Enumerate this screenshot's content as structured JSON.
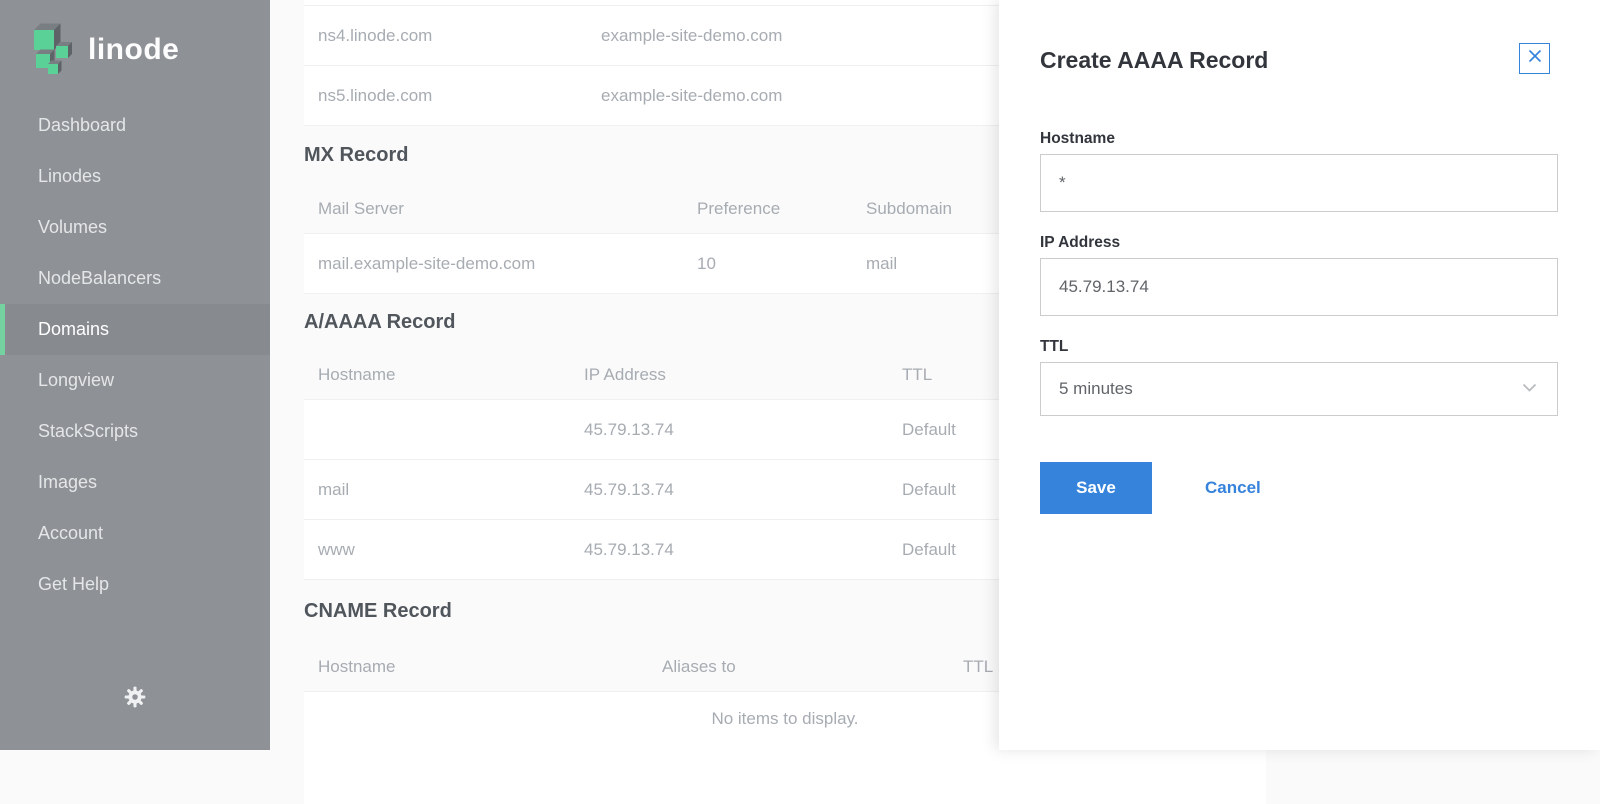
{
  "app": {
    "brand": "linode"
  },
  "sidebar": {
    "items": [
      {
        "label": "Dashboard"
      },
      {
        "label": "Linodes"
      },
      {
        "label": "Volumes"
      },
      {
        "label": "NodeBalancers"
      },
      {
        "label": "Domains"
      },
      {
        "label": "Longview"
      },
      {
        "label": "StackScripts"
      },
      {
        "label": "Images"
      },
      {
        "label": "Account"
      },
      {
        "label": "Get Help"
      }
    ],
    "selected": "Domains"
  },
  "records": {
    "ns": {
      "rows": [
        {
          "name": "ns4.linode.com",
          "target": "example-site-demo.com"
        },
        {
          "name": "ns5.linode.com",
          "target": "example-site-demo.com"
        }
      ]
    },
    "mx": {
      "title": "MX Record",
      "headers": {
        "c1": "Mail Server",
        "c2": "Preference",
        "c3": "Subdomain"
      },
      "rows": [
        {
          "c1": "mail.example-site-demo.com",
          "c2": "10",
          "c3": "mail"
        }
      ]
    },
    "a": {
      "title": "A/AAAA Record",
      "headers": {
        "c1": "Hostname",
        "c2": "IP Address",
        "c3": "TTL"
      },
      "rows": [
        {
          "c1": "",
          "c2": "45.79.13.74",
          "c3": "Default"
        },
        {
          "c1": "mail",
          "c2": "45.79.13.74",
          "c3": "Default"
        },
        {
          "c1": "www",
          "c2": "45.79.13.74",
          "c3": "Default"
        }
      ]
    },
    "cname": {
      "title": "CNAME Record",
      "headers": {
        "c1": "Hostname",
        "c2": "Aliases to",
        "c3": "TTL"
      },
      "empty": "No items to display."
    }
  },
  "drawer": {
    "title": "Create AAAA Record",
    "hostname_label": "Hostname",
    "hostname_value": "*",
    "ip_label": "IP Address",
    "ip_value": "45.79.13.74",
    "ttl_label": "TTL",
    "ttl_value": "5 minutes",
    "save_label": "Save",
    "cancel_label": "Cancel"
  },
  "colors": {
    "accent_green": "#74d1a0",
    "blue": "#3683dc",
    "sidebar_gray": "#8e9196"
  }
}
